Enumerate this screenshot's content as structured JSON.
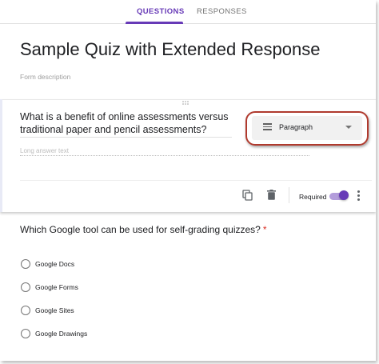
{
  "tabs": [
    {
      "label": "QUESTIONS",
      "active": true
    },
    {
      "label": "RESPONSES",
      "active": false
    }
  ],
  "form": {
    "title": "Sample Quiz with Extended Response",
    "description_placeholder": "Form description"
  },
  "question1": {
    "title": "What is a benefit of online assessments versus traditional paper and pencil assessments?",
    "answer_placeholder": "Long answer text",
    "type_label": "Paragraph",
    "type_icon": "paragraph-icon",
    "required_label": "Required",
    "required_on": true,
    "footer_icons": [
      "duplicate-icon",
      "delete-icon",
      "more-vert-icon"
    ]
  },
  "question2": {
    "title": "Which Google tool can be used for self-grading quizzes?",
    "required_mark": "*",
    "options": [
      "Google Docs",
      "Google Forms",
      "Google Sites",
      "Google Drawings"
    ]
  },
  "colors": {
    "accent": "#673ab7",
    "toggle_track": "#b39ddb",
    "highlight_outline": "#b03a2e",
    "required_asterisk": "#d93025"
  }
}
